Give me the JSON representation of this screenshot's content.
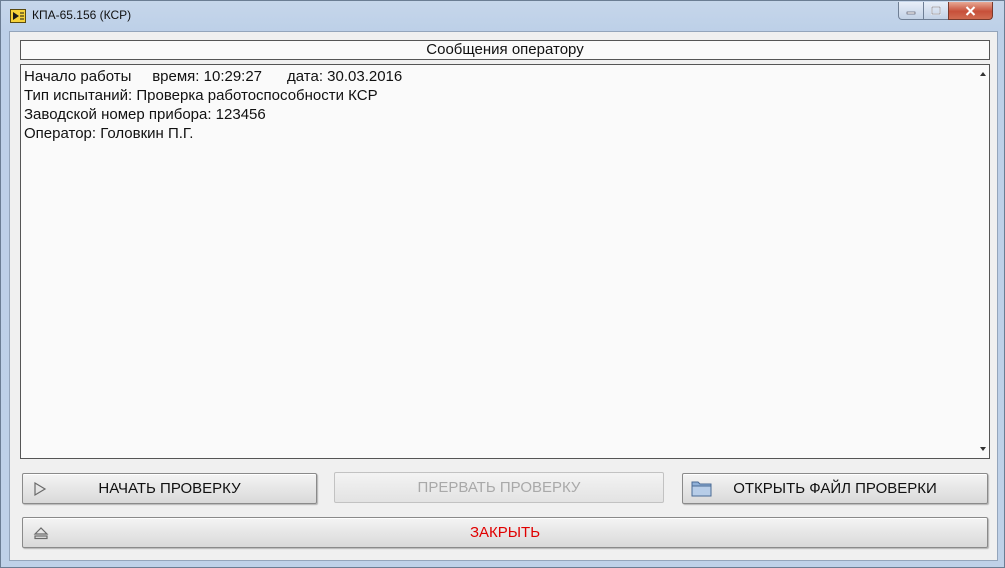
{
  "window": {
    "title": "КПА-65.156 (КСР)"
  },
  "messages": {
    "header": "Сообщения оператору",
    "lines": [
      "Начало работы     время: 10:29:27      дата: 30.03.2016",
      "Тип испытаний: Проверка работоспособности КСР",
      "Заводской номер прибора: 123456",
      "Оператор: Головкин П.Г."
    ]
  },
  "buttons": {
    "start": "НАЧАТЬ ПРОВЕРКУ",
    "abort": "ПРЕРВАТЬ ПРОВЕРКУ",
    "open_file": "ОТКРЫТЬ ФАЙЛ ПРОВЕРКИ",
    "close": "ЗАКРЫТЬ"
  },
  "colors": {
    "close_text": "#e00000",
    "disabled_text": "#a9a9a9"
  }
}
